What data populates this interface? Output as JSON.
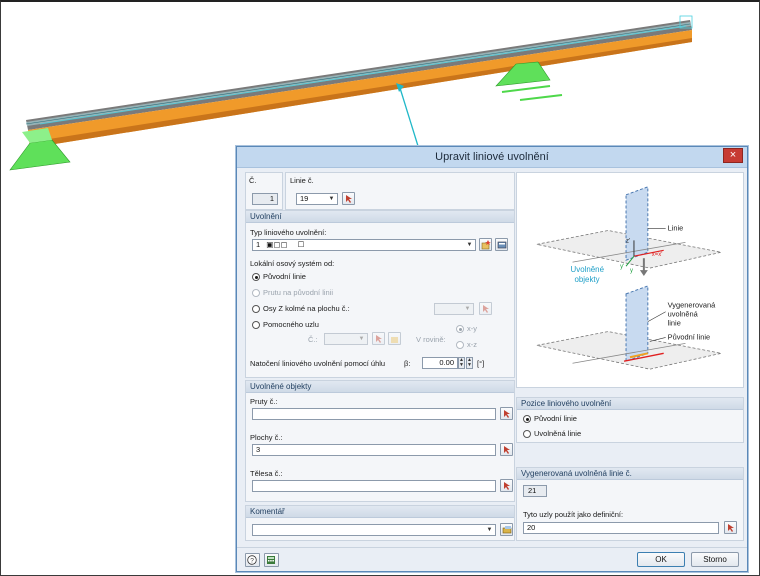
{
  "dialog": {
    "title": "Upravit liniové uvolnění",
    "close_label": "×"
  },
  "top": {
    "no_label": "Č.",
    "no_value": "1",
    "line_label": "Linie č.",
    "line_value": "19"
  },
  "release": {
    "header": "Uvolnění",
    "type_label": "Typ liniového uvolnění:",
    "type_no": "1",
    "type_value": "☐",
    "local_axis_label": "Lokální osový systém od:",
    "options": [
      "Původní linie",
      "Prutu na původní linii",
      "Osy Z kolmé na plochu č.:",
      "Pomocného uzlu"
    ],
    "node_no_label": "Č.:",
    "in_plane_label": "V rovině:",
    "plane_xy": "x-y",
    "plane_xz": "x-z",
    "rotation_label": "Natočení liniového uvolnění pomocí úhlu",
    "beta_label": "β:",
    "beta_value": "0.00",
    "beta_unit": "[°]"
  },
  "released_objects": {
    "header": "Uvolněné objekty",
    "members_label": "Pruty č.:",
    "members_value": "",
    "surfaces_label": "Plochy č.:",
    "surfaces_value": "3",
    "solids_label": "Tělesa č.:",
    "solids_value": ""
  },
  "comment": {
    "header": "Komentář",
    "value": ""
  },
  "preview_labels": {
    "linie": "Linie",
    "released_objects": "Uvolněné\nobjekty",
    "generated": "Vygenerovaná\nuvolněná\nlinie",
    "original": "Původní linie",
    "axis_z": "z'",
    "axis_x": "x=x'",
    "axis_y": "y'",
    "axis_y2": "y"
  },
  "position": {
    "header": "Pozice liniového uvolnění",
    "opt_original": "Původní linie",
    "opt_released": "Uvolněná linie"
  },
  "generated_line": {
    "header": "Vygenerovaná uvolněná linie č.",
    "value": "21",
    "nodes_label": "Tyto uzly použít jako definiční:",
    "nodes_value": "20"
  },
  "footer": {
    "ok": "OK",
    "cancel": "Storno"
  },
  "colors": {
    "beam": "#f09a2a",
    "support": "#5fe05a",
    "title_bar": "#c2d8ef",
    "close": "#c73b33",
    "leader": "#20b8c8"
  }
}
